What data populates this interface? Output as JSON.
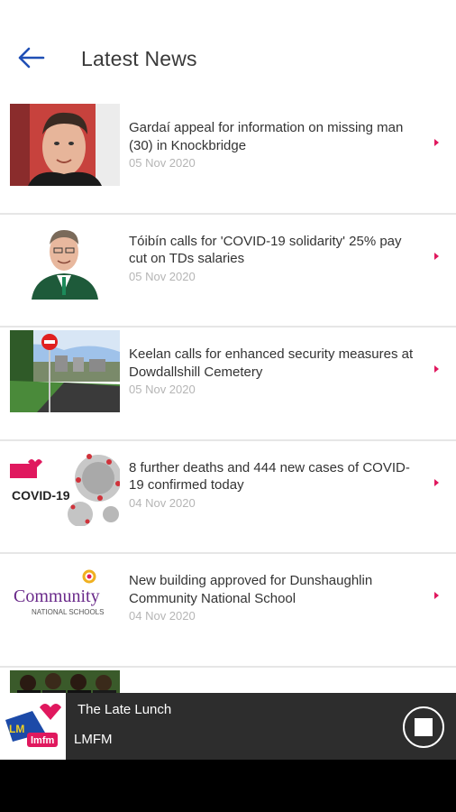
{
  "header": {
    "title": "Latest News",
    "back_icon": "arrow-left-icon",
    "accent_color": "#1f4fb5"
  },
  "news": [
    {
      "title": "Gardaí appeal for information on missing man (30) in Knockbridge",
      "date": "05 Nov 2020",
      "thumbnail": "man-portrait-photo"
    },
    {
      "title": "Tóibín calls for 'COVID-19 solidarity' 25% pay cut on TDs salaries",
      "date": "05 Nov 2020",
      "thumbnail": "politician-portrait-photo"
    },
    {
      "title": "Keelan calls for enhanced security measures at Dowdallshill Cemetery",
      "date": "05 Nov 2020",
      "thumbnail": "cemetery-road-photo"
    },
    {
      "title": "8 further deaths and 444 new cases of COVID-19 confirmed today",
      "date": "04 Nov 2020",
      "thumbnail": "covid-19-graphic"
    },
    {
      "title": "New building approved for Dunshaughlin Community National School",
      "date": "04 Nov 2020",
      "thumbnail": "community-national-schools-logo"
    },
    {
      "title": "",
      "date": "",
      "thumbnail": "group-photo"
    }
  ],
  "colors": {
    "chevron": "#e0185e",
    "player_bg": "#2d2d2d"
  },
  "player": {
    "show": "The Late Lunch",
    "station": "LMFM",
    "logo_text": "lmfm",
    "logo_freq": "LM",
    "stop_icon": "stop-icon"
  },
  "thumbs": {
    "covid_text": "COVID-19",
    "community_text": "Community",
    "schools_text": "NATIONAL SCHOOLS"
  }
}
